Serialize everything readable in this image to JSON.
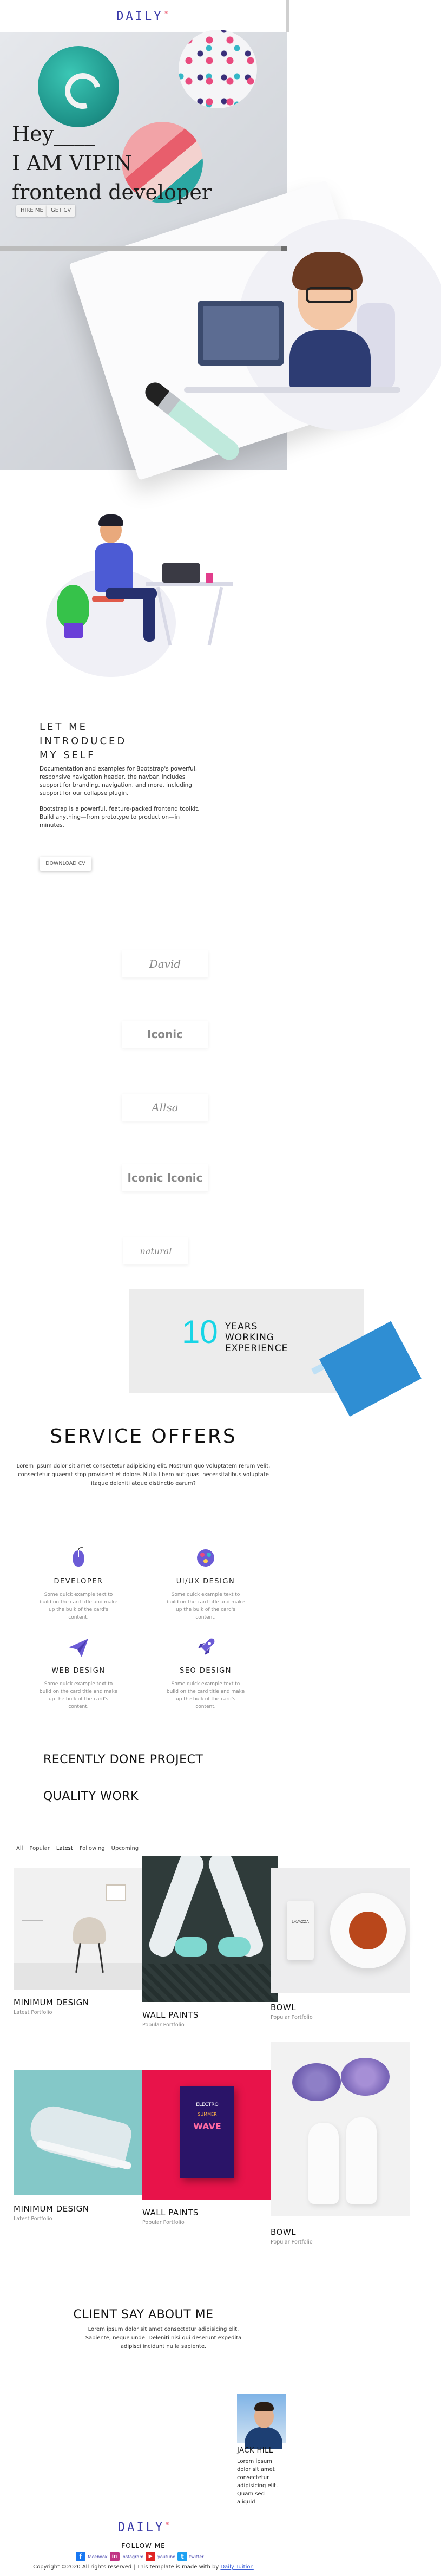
{
  "nav": {
    "brand": "DAILY",
    "brand_mark": "*"
  },
  "hero": {
    "line1": "Hey____",
    "line2": "I AM VIPIN",
    "line3": "frontend developer",
    "hire_label": "HIRE ME",
    "cv_label": "GET CV"
  },
  "about": {
    "title_lines": [
      "LET ME",
      "INTRODUCED",
      "MY SELF"
    ],
    "p1": "Documentation and examples for Bootstrap's powerful, responsive navigation header, the navbar. Includes support for branding, navigation, and more, including support for our collapse plugin.",
    "p2": "Bootstrap is a powerful, feature-packed frontend toolkit. Build anything—from prototype to production—in minutes.",
    "download_label": "DOWNLOAD CV"
  },
  "clients": [
    "David",
    "Iconic",
    "Allsa",
    "Iconic Iconic",
    "natural"
  ],
  "experience": {
    "number": "10",
    "lines": [
      "YEARS",
      "WORKING",
      "EXPERIENCE"
    ]
  },
  "services": {
    "title": "SERVICE OFFERS",
    "subtitle": "Lorem ipsum dolor sit amet consectetur adipisicing elit. Nostrum quo voluptatem rerum velit, consectetur quaerat stop provident et dolore. Nulla libero aut quasi necessitatibus voluptate itaque deleniti atque distinctio earum?",
    "items": [
      {
        "name": "DEVELOPER",
        "desc": "Some quick example text to build on the card title and make up the bulk of the card's content.",
        "icon": "mouse-icon"
      },
      {
        "name": "UI/UX DESIGN",
        "desc": "Some quick example text to build on the card title and make up the bulk of the card's content.",
        "icon": "palette-icon"
      },
      {
        "name": "WEB DESIGN",
        "desc": "Some quick example text to build on the card title and make up the bulk of the card's content.",
        "icon": "paper-plane-icon"
      },
      {
        "name": "SEO DESIGN",
        "desc": "Some quick example text to build on the card title and make up the bulk of the card's content.",
        "icon": "rocket-icon"
      }
    ]
  },
  "projects": {
    "heading1": "RECENTLY DONE PROJECT",
    "heading2": "QUALITY WORK",
    "filters": [
      "All",
      "Popular",
      "Latest",
      "Following",
      "Upcoming"
    ],
    "active_filter": "Latest",
    "works": [
      {
        "title": "MINIMUM DESIGN",
        "sub": "Latest Portfolio"
      },
      {
        "title": "WALL PAINTS",
        "sub": "Popular Portfolio"
      },
      {
        "title": "BOWL",
        "sub": "Popular Portfolio"
      },
      {
        "title": "MINIMUM DESIGN",
        "sub": "Latest Portfolio"
      },
      {
        "title": "WALL PAINTS",
        "sub": "Popular Portfolio"
      },
      {
        "title": "BOWL",
        "sub": "Popular Portfolio"
      }
    ]
  },
  "poster": {
    "top": "ELECTRO",
    "main": "WAVE",
    "small": "SUMMER"
  },
  "bowl_label": "LAVAZZA",
  "testimonial": {
    "title": "CLIENT SAY ABOUT ME",
    "subtitle": "Lorem ipsum dolor sit amet consectetur adipisicing elit. Sapiente, neque unde. Deleniti nisi qui deserunt expedita adipisci incidunt nulla sapiente.",
    "name": "JACK HILL",
    "quote": "Lorem ipsum dolor sit amet consectetur adipisicing elit. Quam sed aliquid!"
  },
  "footer": {
    "brand": "DAILY",
    "follow": "FOLLOW ME",
    "social": [
      {
        "letter": "f",
        "label": "facebook",
        "color": "#1877f2"
      },
      {
        "letter": "in",
        "label": "instagram",
        "color": "#c13584"
      },
      {
        "letter": "▶",
        "label": "youtube",
        "color": "#e02424"
      },
      {
        "letter": "t",
        "label": "twitter",
        "color": "#1da1f2"
      }
    ],
    "copyright_prefix": "Copyright ©2020 All rights reserved | This template is made with by",
    "copyright_link": "Daily Tuition"
  }
}
